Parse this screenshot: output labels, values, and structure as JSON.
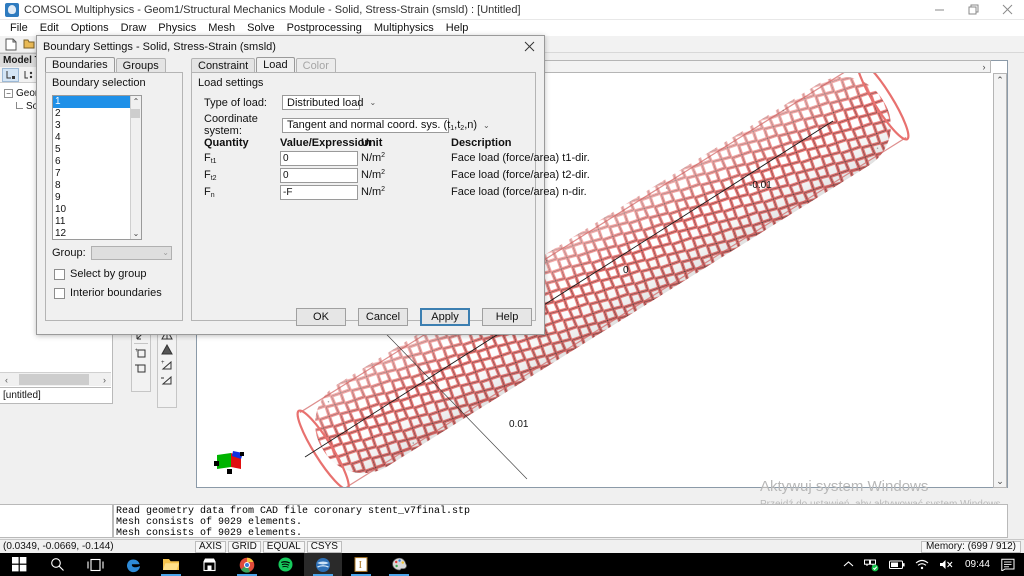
{
  "window": {
    "title": "COMSOL Multiphysics - Geom1/Structural Mechanics Module - Solid, Stress-Strain (smsld) : [Untitled]",
    "app_icon": "comsol-icon",
    "minimize": "minimize-icon",
    "maximize": "restore-icon",
    "close": "close-icon"
  },
  "menubar": {
    "items": [
      "File",
      "Edit",
      "Options",
      "Draw",
      "Physics",
      "Mesh",
      "Solve",
      "Postprocessing",
      "Multiphysics",
      "Help"
    ]
  },
  "toolbar": {
    "buttons": [
      "new-document-icon",
      "open-folder-icon"
    ]
  },
  "model_tree": {
    "caption": "Model Tree",
    "toolbar_buttons": [
      "tree-view-icon",
      "list-view-icon"
    ],
    "root": "Geom1",
    "child": "Solid, Stress-Strain (smsld)",
    "status": "[untitled]",
    "scroll_left": "‹",
    "scroll_right": "›"
  },
  "side_tools": {
    "group1": [
      "measure-icon",
      "zoom-in-box-icon",
      "zoom-out-box-icon"
    ],
    "group2": [
      "mesh-triangle-icon",
      "mesh-solid-icon",
      "mesh-refine-icon",
      "mesh-coarse-icon"
    ]
  },
  "dialog": {
    "title": "Boundary Settings - Solid, Stress-Strain (smsld)",
    "close_icon": "close-icon",
    "left_tabs": [
      {
        "label": "Boundaries",
        "selected": true,
        "disabled": false
      },
      {
        "label": "Groups",
        "selected": false,
        "disabled": false
      }
    ],
    "right_tabs": [
      {
        "label": "Constraint",
        "selected": false,
        "disabled": false
      },
      {
        "label": "Load",
        "selected": true,
        "disabled": false
      },
      {
        "label": "Color",
        "selected": false,
        "disabled": true
      }
    ],
    "boundary_selection": {
      "label": "Boundary selection",
      "items": [
        "1",
        "2",
        "3",
        "4",
        "5",
        "6",
        "7",
        "8",
        "9",
        "10",
        "11",
        "12"
      ],
      "selected_index": 0,
      "scroll_up": "⌃",
      "scroll_down": "⌄"
    },
    "group": {
      "label": "Group:",
      "value": "",
      "arrow": "⌄"
    },
    "checkboxes": [
      {
        "label": "Select by group",
        "checked": false
      },
      {
        "label": "Interior boundaries",
        "checked": false
      }
    ],
    "load_settings": {
      "group_label": "Load settings",
      "type_of_load": {
        "label": "Type of load:",
        "value": "Distributed load",
        "arrow": "⌄"
      },
      "coordinate_system": {
        "label": "Coordinate system:",
        "value_prefix": "Tangent and normal coord. sys. (t",
        "value_sub1": "1",
        "value_mid": ",t",
        "value_sub2": "2",
        "value_suffix": ",n)",
        "arrow": "⌄"
      },
      "columns": [
        "Quantity",
        "Value/Expression",
        "Unit",
        "Description"
      ],
      "rows": [
        {
          "quantity_base": "F",
          "quantity_sub": "t1",
          "value": "0",
          "unit_base": "N/m",
          "unit_sup": "2",
          "description": "Face load (force/area) t1-dir."
        },
        {
          "quantity_base": "F",
          "quantity_sub": "t2",
          "value": "0",
          "unit_base": "N/m",
          "unit_sup": "2",
          "description": "Face load (force/area) t2-dir."
        },
        {
          "quantity_base": "F",
          "quantity_sub": "n",
          "value": "-F",
          "unit_base": "N/m",
          "unit_sup": "2",
          "description": "Face load (force/area) n-dir."
        }
      ]
    },
    "buttons": [
      {
        "label": "OK",
        "default": false
      },
      {
        "label": "Cancel",
        "default": false
      },
      {
        "label": "Apply",
        "default": true
      },
      {
        "label": "Help",
        "default": false
      }
    ]
  },
  "graphics": {
    "axis_labels": [
      "-0.01",
      "0",
      "0.01"
    ],
    "model_color": "#f08080",
    "orientation_widget": "axis-orientation-icon",
    "hscroll_left": "‹",
    "hscroll_right": "›",
    "vscroll_up": "⌃",
    "vscroll_down": "⌄"
  },
  "watermark": {
    "title": "Aktywuj system Windows",
    "subtitle": "Przejdź do ustawień, aby aktywować system Windows."
  },
  "message_log": {
    "lines": [
      "Read geometry data from CAD file coronary stent_v7final.stp",
      "Mesh consists of 9029 elements.",
      "Mesh consists of 9029 elements."
    ]
  },
  "statusbar": {
    "coordinates": "(0.0349, -0.0669, -0.144)",
    "flags": [
      "AXIS",
      "GRID",
      "EQUAL",
      "CSYS"
    ],
    "memory": "Memory: (699 / 912)"
  },
  "taskbar": {
    "start": "windows-start-icon",
    "items": [
      {
        "name": "search-icon",
        "running": false,
        "active": false
      },
      {
        "name": "task-view-icon",
        "running": false,
        "active": false
      },
      {
        "name": "edge-browser-icon",
        "running": false,
        "active": false
      },
      {
        "name": "file-explorer-icon",
        "running": true,
        "active": false
      },
      {
        "name": "microsoft-store-icon",
        "running": false,
        "active": false
      },
      {
        "name": "chrome-browser-icon",
        "running": true,
        "active": false
      },
      {
        "name": "spotify-icon",
        "running": false,
        "active": false
      },
      {
        "name": "comsol-icon",
        "running": true,
        "active": true
      },
      {
        "name": "text-editor-icon",
        "running": true,
        "active": false
      },
      {
        "name": "paint-icon",
        "running": true,
        "active": false
      }
    ],
    "tray": [
      "show-hidden-icons-chevron",
      "network-status-icon",
      "battery-icon",
      "wifi-icon",
      "volume-muted-icon"
    ],
    "clock": "09:44",
    "action_center": "action-center-icon"
  }
}
